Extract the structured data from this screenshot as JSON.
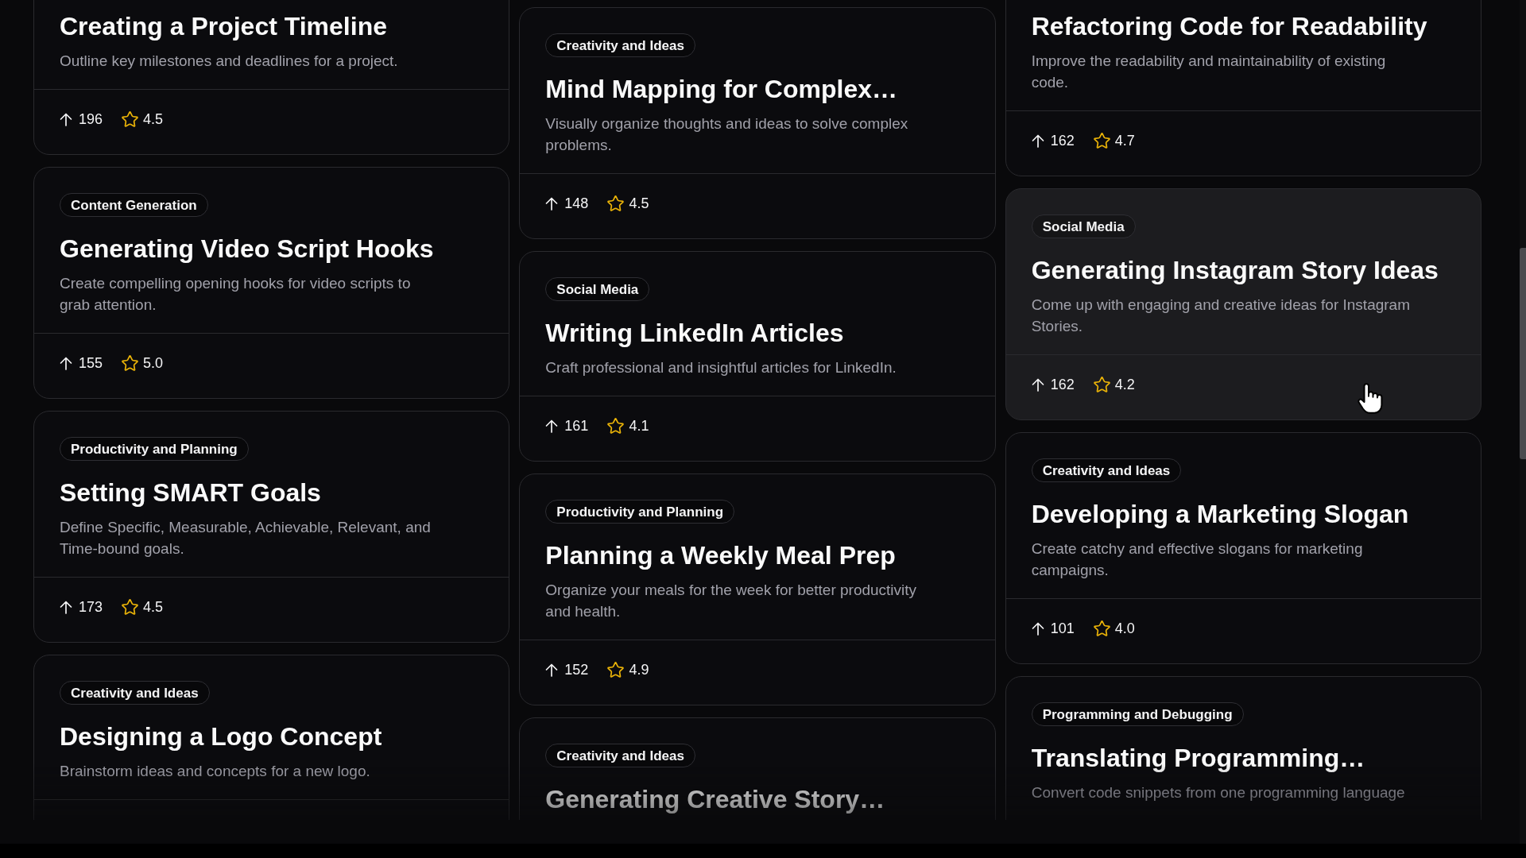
{
  "columns": [
    {
      "cards": [
        {
          "title": "Creating a Project Timeline",
          "description": "Outline key milestones and deadlines for a project.",
          "upvotes": "196",
          "rating": "4.5",
          "hovered": false
        },
        {
          "category": "Content Generation",
          "title": "Generating Video Script Hooks",
          "description": "Create compelling opening hooks for video scripts to grab attention.",
          "upvotes": "155",
          "rating": "5.0",
          "hovered": false
        },
        {
          "category": "Productivity and Planning",
          "title": "Setting SMART Goals",
          "description": "Define Specific, Measurable, Achievable, Relevant, and Time-bound goals.",
          "upvotes": "173",
          "rating": "4.5",
          "hovered": false
        },
        {
          "category": "Creativity and Ideas",
          "title": "Designing a Logo Concept",
          "description": "Brainstorm ideas and concepts for a new logo.",
          "hovered": false
        }
      ]
    },
    {
      "cards": [
        {
          "category": "Creativity and Ideas",
          "title": "Mind Mapping for Complex…",
          "description": "Visually organize thoughts and ideas to solve complex problems.",
          "upvotes": "148",
          "rating": "4.5",
          "hovered": false
        },
        {
          "category": "Social Media",
          "title": "Writing LinkedIn Articles",
          "description": "Craft professional and insightful articles for LinkedIn.",
          "upvotes": "161",
          "rating": "4.1",
          "hovered": false
        },
        {
          "category": "Productivity and Planning",
          "title": "Planning a Weekly Meal Prep",
          "description": "Organize your meals for the week for better productivity and health.",
          "upvotes": "152",
          "rating": "4.9",
          "hovered": false
        },
        {
          "category": "Creativity and Ideas",
          "title": "Generating Creative Story…",
          "hovered": false
        }
      ]
    },
    {
      "cards": [
        {
          "title": "Refactoring Code for Readability",
          "description": "Improve the readability and maintainability of existing code.",
          "upvotes": "162",
          "rating": "4.7",
          "hovered": false
        },
        {
          "category": "Social Media",
          "title": "Generating Instagram Story Ideas",
          "description": "Come up with engaging and creative ideas for Instagram Stories.",
          "upvotes": "162",
          "rating": "4.2",
          "hovered": true
        },
        {
          "category": "Creativity and Ideas",
          "title": "Developing a Marketing Slogan",
          "description": "Create catchy and effective slogans for marketing campaigns.",
          "upvotes": "101",
          "rating": "4.0",
          "hovered": false
        },
        {
          "category": "Programming and Debugging",
          "title": "Translating Programming…",
          "description": "Convert code snippets from one programming language",
          "hovered": false
        }
      ]
    }
  ]
}
